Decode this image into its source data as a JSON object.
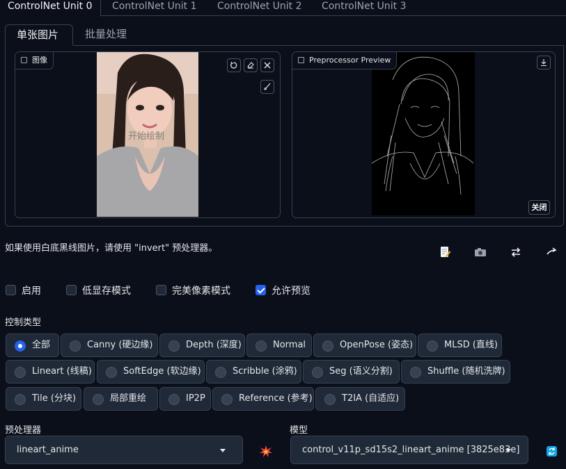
{
  "unit_tabs": [
    "ControlNet Unit 0",
    "ControlNet Unit 1",
    "ControlNet Unit 2",
    "ControlNet Unit 3"
  ],
  "sub_tabs": [
    "单张图片",
    "批量处理"
  ],
  "image_panel": {
    "label": "图像",
    "overlay_text": "开始绘制"
  },
  "preview_panel": {
    "label": "Preprocessor Preview",
    "close_label": "关闭"
  },
  "hint": "如果使用白底黑线图片，请使用 \"invert\" 预处理器。",
  "tool_icons": [
    "edit-icon",
    "camera-icon",
    "swap-icon",
    "send-up-icon"
  ],
  "checkboxes": [
    {
      "label": "启用",
      "checked": false
    },
    {
      "label": "低显存模式",
      "checked": false
    },
    {
      "label": "完美像素模式",
      "checked": false
    },
    {
      "label": "允许预览",
      "checked": true
    }
  ],
  "control_type_label": "控制类型",
  "control_types": [
    [
      "全部",
      "Canny (硬边缘)",
      "Depth (深度)",
      "Normal",
      "OpenPose (姿态)",
      "MLSD (直线)"
    ],
    [
      "Lineart (线稿)",
      "SoftEdge (软边缘)",
      "Scribble (涂鸦)",
      "Seg (语义分割)",
      "Shuffle (随机洗牌)"
    ],
    [
      "Tile (分块)",
      "局部重绘",
      "IP2P",
      "Reference (参考)",
      "T2IA (自适应)"
    ]
  ],
  "selected_control_type": "全部",
  "preprocessor": {
    "label": "预处理器",
    "value": "lineart_anime"
  },
  "model": {
    "label": "模型",
    "value": "control_v11p_sd15s2_lineart_anime [3825e83e]"
  },
  "colors": {
    "bg": "#0b0f19",
    "panel": "#1f2937",
    "border": "#374151",
    "accent": "#2563eb"
  }
}
